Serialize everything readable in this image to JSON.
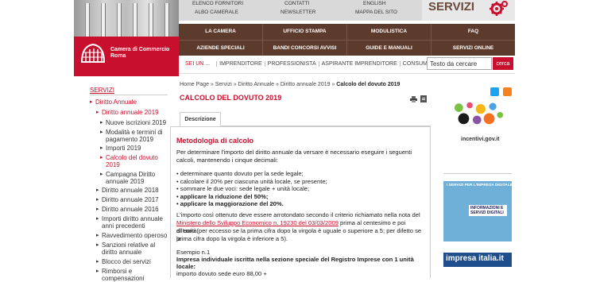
{
  "header": {
    "top_links": [
      "ELENCO FORNITORI",
      "CONTATTI",
      "ENGLISH",
      "ALBO CAMERALE",
      "NEWSLETTER",
      "MAPPA DEL SITO"
    ],
    "servizi_label": "SERVIZI",
    "logo_line1": "Camera di Commercio",
    "logo_line2": "Roma"
  },
  "nav": {
    "row1": [
      "LA CAMERA",
      "UFFICIO STAMPA",
      "MODULISTICA",
      "FAQ"
    ],
    "row2": [
      "AZIENDE SPECIALI",
      "BANDI CONCORSI AVVISI",
      "GUIDE E MANUALI",
      "SERVIZI ONLINE"
    ]
  },
  "seiun": {
    "lead": "SEI UN ...",
    "items": [
      "IMPRENDITORE",
      "PROFESSIONISTA",
      "ASPIRANTE IMPRENDITORE",
      "CONSUMATORE"
    ]
  },
  "search": {
    "value": "Testo da cercare",
    "button": "cerca"
  },
  "sidebar": {
    "title": "SERVIZI",
    "items": [
      {
        "label": "Diritto Annuale"
      },
      {
        "label": "Diritto annuale 2019"
      },
      {
        "label": "Nuove iscrizioni 2019"
      },
      {
        "label": "Modalità e termini di"
      },
      {
        "label": "pagamento 2019"
      },
      {
        "label": "Importi 2019"
      },
      {
        "label": "Calcolo del dovuto"
      },
      {
        "label": "2019"
      },
      {
        "label": "Campagna Diritto"
      },
      {
        "label": "annuale 2019"
      },
      {
        "label": "Diritto annuale 2018"
      },
      {
        "label": "Diritto annuale 2017"
      },
      {
        "label": "Diritto annuale 2016"
      },
      {
        "label": "Importi diritto annuale"
      },
      {
        "label": "anni precedenti"
      },
      {
        "label": "Ravvedimento operoso"
      },
      {
        "label": "Sanzioni relative al"
      },
      {
        "label": "diritto annuale"
      },
      {
        "label": "Blocco dei servizi"
      },
      {
        "label": "Rimborsi e"
      },
      {
        "label": "compensazioni"
      }
    ]
  },
  "breadcrumb": {
    "path": "Home Page » Servizi » Diritto Annuale » Diritto annuale 2019 » ",
    "current": "Calcolo del dovuto 2019"
  },
  "page_title": "CALCOLO DEL DOVUTO 2019",
  "tab_label": "Descrizione",
  "content": {
    "heading": "Metodologia di calcolo",
    "intro1": "Per determinare l'importo del diritto annuale da versare è necessario eseguire i seguenti",
    "intro2": "calcoli, mantenendo i cinque decimali:",
    "bullets": [
      "determinare quanto dovuto per la sede legale;",
      "calcolare il 20% per ciascuna unità locale, se presente;",
      "sommare le due voci: sede legale + unità locale;",
      "applicare la riduzione del 50%;",
      "applicare la maggiorazione del 20%."
    ],
    "round1": "L'importo così ottenuto deve essere arrotondato secondo il criterio richiamato nella nota del",
    "round_link": "Ministero dello Sviluppo Economico n. 19230 del 03/03/2009",
    "round2_tail": " prima al centesimo e poi all'unità",
    "round3": "di euro (per eccesso se la prima cifra dopo la virgola è uguale o superiore a 5; per difetto se la",
    "round4": "prima cifra dopo la virgola è inferiore a 5).",
    "example_label": "Esempio n.1",
    "example_bold1": "Impresa individuale iscritta nella sezione speciale del Registro Imprese con 1 unità",
    "example_bold2": "locale:",
    "example_line": "importo dovuto sede euro 88,00 +"
  },
  "right": {
    "incentivi": "incentivi.gov.it",
    "digital_head": "I SERVIZI PER L'IMPRESA DIGITALE",
    "digital_title": "INFORMAZIONI E SERVIZI DIGITALI",
    "impresa": "impresa italia.it"
  },
  "colors": {
    "brand_red": "#c8102e",
    "nav_brown": "#5d3b2c"
  }
}
